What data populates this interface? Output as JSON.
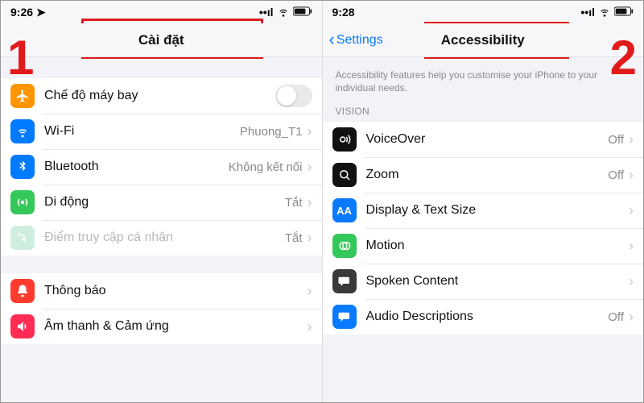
{
  "left": {
    "step_number": "1",
    "status": {
      "time": "9:26"
    },
    "header": {
      "title": "Cài đặt"
    },
    "group1": {
      "airplane": {
        "label": "Chế độ máy bay"
      },
      "wifi": {
        "label": "Wi-Fi",
        "value": "Phuong_T1"
      },
      "bluetooth": {
        "label": "Bluetooth",
        "value": "Không kết nối"
      },
      "cellular": {
        "label": "Di động",
        "value": "Tắt"
      },
      "hotspot": {
        "label": "Điểm truy cập cá nhân",
        "value": "Tắt"
      }
    },
    "group2": {
      "notifications": {
        "label": "Thông báo"
      },
      "sounds": {
        "label": "Âm thanh & Cảm ứng"
      }
    }
  },
  "right": {
    "step_number": "2",
    "status": {
      "time": "9:28"
    },
    "header": {
      "back": "Settings",
      "title": "Accessibility"
    },
    "description": "Accessibility features help you customise your iPhone to your individual needs.",
    "section_header": "VISION",
    "vision": {
      "voiceover": {
        "label": "VoiceOver",
        "value": "Off"
      },
      "zoom": {
        "label": "Zoom",
        "value": "Off"
      },
      "display": {
        "label": "Display & Text Size"
      },
      "motion": {
        "label": "Motion"
      },
      "spoken": {
        "label": "Spoken Content"
      },
      "audiodesc": {
        "label": "Audio Descriptions",
        "value": "Off"
      }
    }
  }
}
